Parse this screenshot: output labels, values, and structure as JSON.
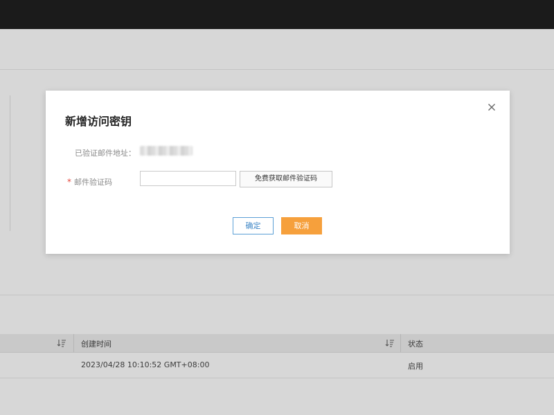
{
  "dialog": {
    "title": "新增访问密钥",
    "verified_email_label": "已验证邮件地址：",
    "verification_code_label": "邮件验证码",
    "required_mark": "*",
    "code_input_value": "",
    "code_input_placeholder": "",
    "get_code_button": "免费获取邮件验证码",
    "confirm_button": "确定",
    "cancel_button": "取消"
  },
  "table": {
    "columns": [
      "创建时间",
      "状态"
    ],
    "rows": [
      {
        "created": "2023/04/28 10:10:52 GMT+08:00",
        "status": "启用"
      }
    ]
  },
  "colors": {
    "accent": "#f6a03c",
    "confirm_border": "#5b9fd6",
    "required": "#e5483e"
  }
}
